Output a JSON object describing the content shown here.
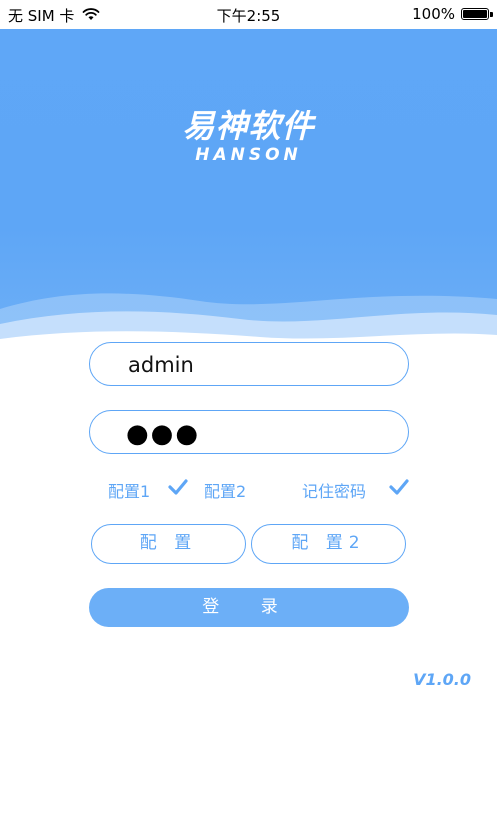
{
  "status_bar": {
    "carrier": "无 SIM 卡",
    "time": "下午2:55",
    "battery_percent": "100%",
    "battery_level": 1.0
  },
  "header": {
    "logo_cn": "易神软件",
    "logo_en": "HANSON",
    "color": "#5ea6f6"
  },
  "form": {
    "username_value": "admin",
    "password_masked": "●●●"
  },
  "options": {
    "config1_label": "配置1",
    "config1_checked": true,
    "config2_label": "配置2",
    "config2_checked": false,
    "remember_label": "记住密码",
    "remember_checked": true
  },
  "buttons": {
    "config_label": "配 置",
    "config2_label": "配 置2",
    "login_label": "登 录"
  },
  "version": "V1.0.0",
  "accent_color": "#5ea6f6"
}
